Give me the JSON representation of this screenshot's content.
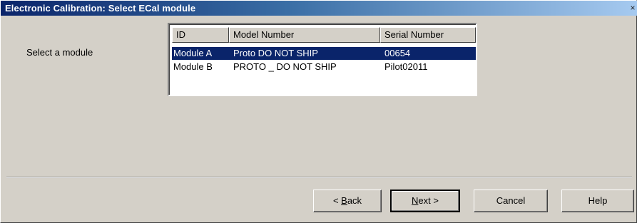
{
  "window": {
    "title": "Electronic Calibration: Select ECal module",
    "close_glyph": "×"
  },
  "prompt": "Select a module",
  "modules": {
    "columns": [
      "ID",
      "Model Number",
      "Serial Number"
    ],
    "rows": [
      {
        "id": "Module A",
        "model": "Proto DO NOT SHIP",
        "serial": "00654",
        "selected": true
      },
      {
        "id": "Module B",
        "model": "PROTO _ DO NOT SHIP",
        "serial": "Pilot02011",
        "selected": false
      }
    ]
  },
  "buttons": {
    "back": {
      "mnemonic": "B",
      "rest": "ack",
      "prefix": "< "
    },
    "next": {
      "mnemonic": "N",
      "rest": "ext",
      "suffix": " >"
    },
    "cancel": "Cancel",
    "help": "Help"
  },
  "colors": {
    "selection_bg": "#0a246a",
    "title_start": "#0a246a",
    "title_end": "#a6caf0"
  }
}
